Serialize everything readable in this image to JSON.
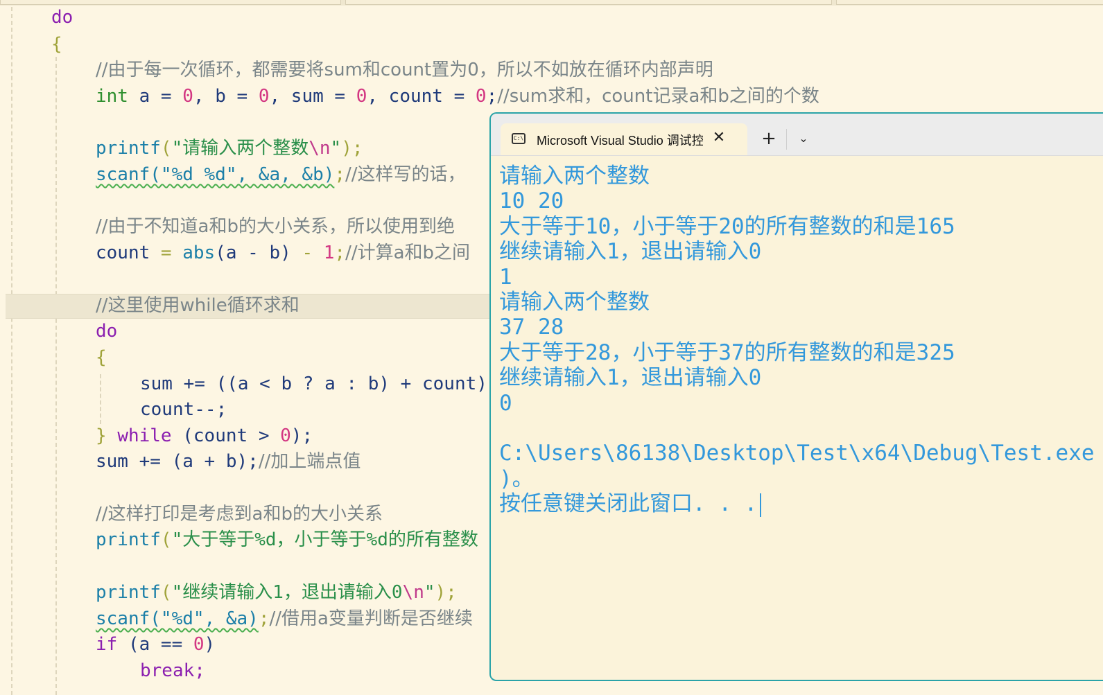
{
  "editor": {
    "lines": {
      "do_outer": "do",
      "brace_open": "{",
      "comment_reset": "//由于每一次循环，都需要将sum和count置为0，所以不如放在循环内部声明",
      "decl": {
        "type": "int",
        "body1": " a = ",
        "v1": "0",
        "body2": ", b = ",
        "v2": "0",
        "body3": ", sum = ",
        "v3": "0",
        "body4": ", count = ",
        "v4": "0",
        "end": ";",
        "comment": "//sum求和，count记录a和b之间的个数"
      },
      "printf1": {
        "fn": "printf",
        "open": "(",
        "str": "\"请输入两个整数",
        "esc": "\\n",
        "str_end": "\"",
        "close": ");"
      },
      "scanf1": {
        "call": "scanf(\"%d %d\", &a, &b)",
        "end": ";",
        "comment": "//这样写的话，"
      },
      "comment_abs": "//由于不知道a和b的大小关系，所以使用到绝",
      "count_line": {
        "var": "count",
        "eq": " = ",
        "fn": "abs",
        "args": "(a - b)",
        "minus": " - ",
        "num": "1",
        "end": ";",
        "comment": "//计算a和b之间"
      },
      "comment_while": "//这里使用while循环求和",
      "do_inner": "do",
      "brace_inner_open": "{",
      "sum_line": "sum += ((a < b ? a : b) + count)",
      "count_dec": "count--;",
      "while_line": {
        "brace": "} ",
        "kw": "while",
        "cond_open": " (count > ",
        "num": "0",
        "cond_close": ");"
      },
      "sum_end": {
        "code": "sum += (a + b);",
        "comment": "//加上端点值"
      },
      "comment_print": "//这样打印是考虑到a和b的大小关系",
      "printf2": {
        "fn": "printf",
        "open": "(",
        "str": "\"大于等于%d，小于等于%d的所有整数"
      },
      "printf3": {
        "fn": "printf",
        "open": "(",
        "str": "\"继续请输入1，退出请输入0",
        "esc": "\\n",
        "str_end": "\"",
        "close": ");"
      },
      "scanf2": {
        "call": "scanf(\"%d\", &a)",
        "end": ";",
        "comment": "//借用a变量判断是否继续"
      },
      "if_line": {
        "kw": "if",
        "cond": " (a == ",
        "num": "0",
        "close": ")"
      },
      "break_line": "break;"
    }
  },
  "terminal": {
    "tab_icon": "C:\\",
    "tab_title": "Microsoft Visual Studio 调试控制台",
    "close_glyph": "✕",
    "new_tab_glyph": "+",
    "dropdown_glyph": "⌄",
    "accent_color": "#3398db",
    "output_lines": [
      "请输入两个整数",
      "10 20",
      "大于等于10，小于等于20的所有整数的和是165",
      "继续请输入1，退出请输入0",
      "1",
      "请输入两个整数",
      "37 28",
      "大于等于28，小于等于37的所有整数的和是325",
      "继续请输入1，退出请输入0",
      "0",
      "",
      "C:\\Users\\86138\\Desktop\\Test\\x64\\Debug\\Test.exe",
      ")。",
      "按任意键关闭此窗口. . ."
    ]
  }
}
